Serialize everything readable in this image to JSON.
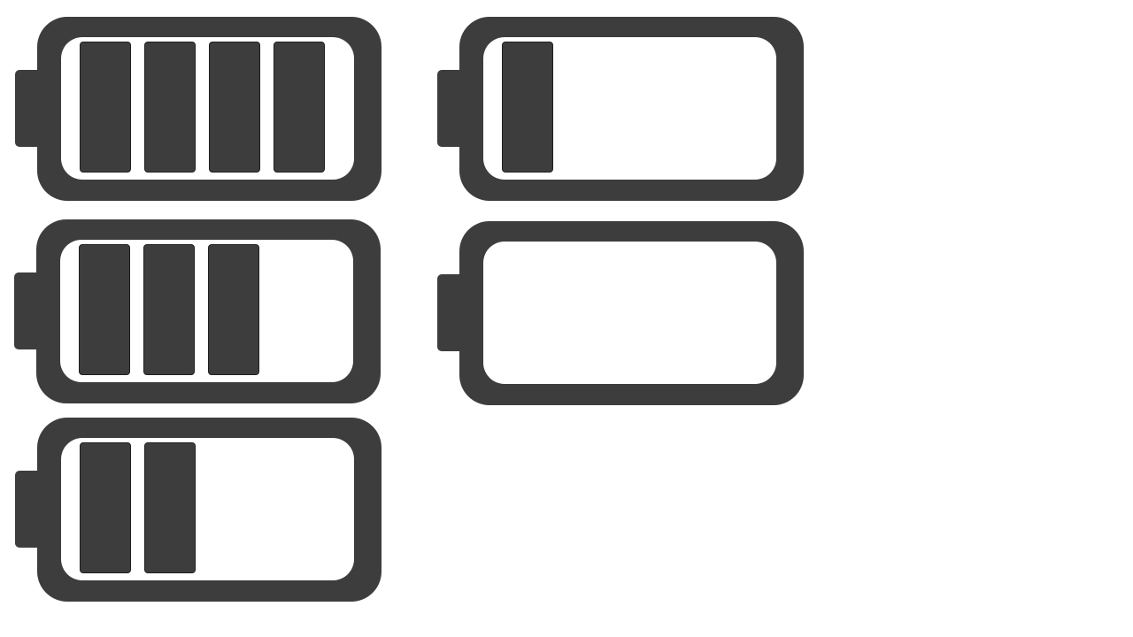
{
  "colors": {
    "icon": "#3d3d3d",
    "background": "#ffffff"
  },
  "batteries": [
    {
      "icon": "battery-full-icon",
      "filled_bars": 4,
      "total_bars": 4
    },
    {
      "icon": "battery-low-icon",
      "filled_bars": 1,
      "total_bars": 4
    },
    {
      "icon": "battery-three-quarter-icon",
      "filled_bars": 3,
      "total_bars": 4
    },
    {
      "icon": "battery-empty-icon",
      "filled_bars": 0,
      "total_bars": 4
    },
    {
      "icon": "battery-half-icon",
      "filled_bars": 2,
      "total_bars": 4
    }
  ]
}
